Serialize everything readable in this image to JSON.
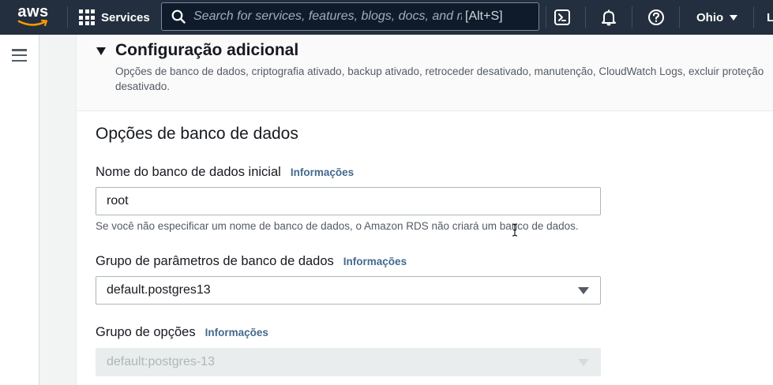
{
  "topnav": {
    "logo_text": "aws",
    "services_label": "Services",
    "search_placeholder": "Search for services, features, blogs, docs, and more",
    "search_shortcut": "[Alt+S]",
    "region_label": "Ohio",
    "user_label_cut": "L"
  },
  "icons": [
    "aws-logo",
    "services-grid-icon",
    "search-icon",
    "cloudshell-icon",
    "bell-icon",
    "help-icon",
    "region-caret-icon",
    "menu-icon",
    "collapse-triangle-icon",
    "select-caret-icon",
    "text-cursor-icon"
  ],
  "section": {
    "title": "Configuração adicional",
    "description": "Opções de banco de dados, criptografia ativado, backup ativado, retroceder desativado, manutenção, CloudWatch Logs, excluir proteção desativado."
  },
  "db_options": {
    "title": "Opções de banco de dados",
    "initial_db_name": {
      "label": "Nome do banco de dados inicial",
      "info": "Informações",
      "value": "root",
      "hint": "Se você não especificar um nome de banco de dados, o Amazon RDS não criará um banco de dados."
    },
    "param_group": {
      "label": "Grupo de parâmetros de banco de dados",
      "info": "Informações",
      "value": "default.postgres13"
    },
    "option_group": {
      "label": "Grupo de opções",
      "info": "Informações",
      "value": "default:postgres-13",
      "disabled": true
    }
  },
  "colors": {
    "nav_bg": "#232f3e",
    "link": "#44698f",
    "disabled_bg": "#eaeded"
  }
}
